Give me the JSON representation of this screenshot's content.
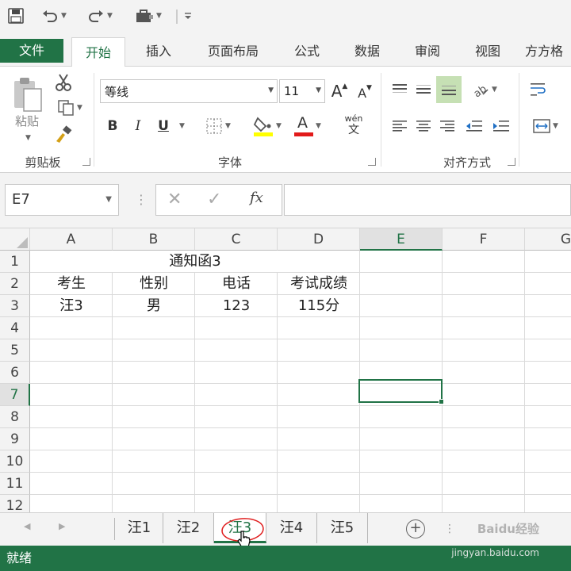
{
  "quick_access": {
    "save_icon": "save-icon",
    "undo_icon": "undo-icon",
    "redo_icon": "redo-icon",
    "customize_icon": "customize-qat-icon"
  },
  "ribbon_tabs": [
    {
      "label": "文件"
    },
    {
      "label": "开始"
    },
    {
      "label": "插入"
    },
    {
      "label": "页面布局"
    },
    {
      "label": "公式"
    },
    {
      "label": "数据"
    },
    {
      "label": "审阅"
    },
    {
      "label": "视图"
    },
    {
      "label": "方方格"
    }
  ],
  "ribbon": {
    "clipboard": {
      "paste_label": "粘贴",
      "group_label": "剪贴板"
    },
    "font": {
      "font_name": "等线",
      "font_size": "11",
      "bold": "B",
      "italic": "I",
      "underline": "U",
      "font_color_glyph": "A",
      "phonetic_top": "wén",
      "phonetic_bottom": "文",
      "grow_font": "A",
      "shrink_font": "A",
      "group_label": "字体"
    },
    "alignment": {
      "group_label": "对齐方式"
    }
  },
  "formula_bar": {
    "name_box": "E7",
    "fx": "fx",
    "formula": ""
  },
  "sheet": {
    "columns": [
      "A",
      "B",
      "C",
      "D",
      "E",
      "F",
      "G"
    ],
    "rows": [
      "1",
      "2",
      "3",
      "4",
      "5",
      "6",
      "7",
      "8",
      "9",
      "10",
      "11",
      "12"
    ],
    "selected_cell": "E7",
    "title": "通知函3",
    "header_row": [
      "考生",
      "性别",
      "电话",
      "考试成绩"
    ],
    "data_row": [
      "汪3",
      "男",
      "123",
      "115分"
    ]
  },
  "sheet_tabs": [
    "汪1",
    "汪2",
    "汪3",
    "汪4",
    "汪5"
  ],
  "active_sheet": "汪3",
  "status": {
    "text": "就绪"
  },
  "watermark": {
    "text": "Baidu经验",
    "url": "jingyan.baidu.com"
  },
  "colors": {
    "accent": "#217346",
    "annotation": "#e02020"
  }
}
